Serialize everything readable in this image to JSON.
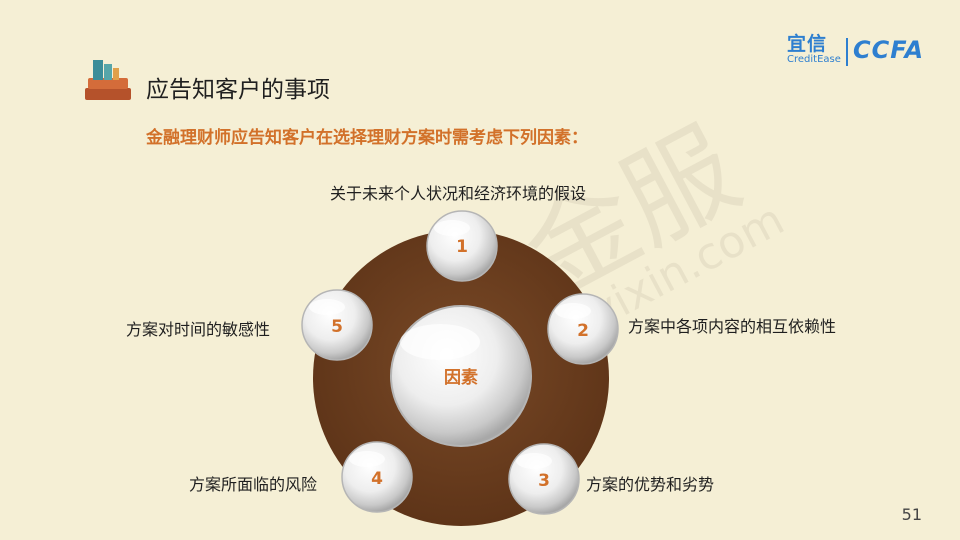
{
  "slide": {
    "title": "应告知客户的事项",
    "subtitle": "金融理财师应告知客户在选择理财方案时需考虑下列因素：",
    "page_number": "51"
  },
  "logos": {
    "yixin_cn": "宜信",
    "yixin_en": "CreditEase",
    "ccfa": "CCFA"
  },
  "watermark": {
    "text_cn": "星火金服",
    "text_url": "xinghuo.yixin.com"
  },
  "diagram": {
    "center_label": "因素",
    "nodes": [
      {
        "number": "1",
        "label": "关于未来个人状况和经济环境的假设"
      },
      {
        "number": "2",
        "label": "方案中各项内容的相互依赖性"
      },
      {
        "number": "3",
        "label": "方案的优势和劣势"
      },
      {
        "number": "4",
        "label": "方案所面临的风险"
      },
      {
        "number": "5",
        "label": "方案对时间的敏感性"
      }
    ]
  },
  "colors": {
    "background": "#f5efd5",
    "accent_orange": "#d2712a",
    "disc_brown": "#6b3e20",
    "logo_blue": "#2e7fd0"
  }
}
